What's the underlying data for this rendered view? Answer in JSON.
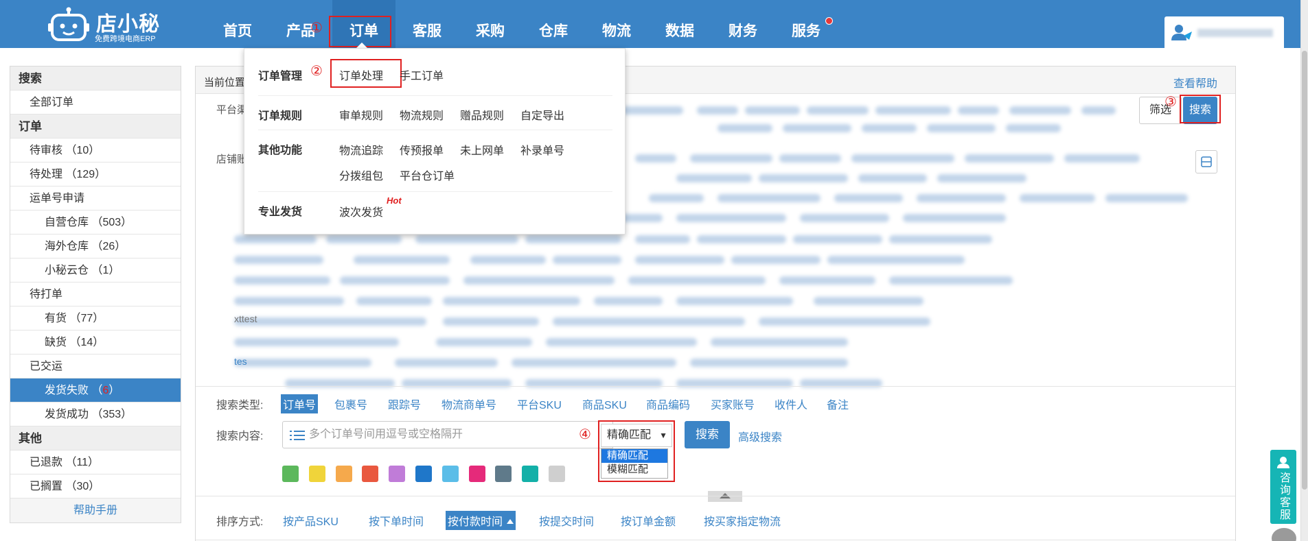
{
  "logo": {
    "name": "店小秘",
    "subtitle": "免费跨境电商ERP"
  },
  "nav": {
    "items": [
      "首页",
      "产品",
      "订单",
      "客服",
      "采购",
      "仓库",
      "物流",
      "数据",
      "财务",
      "服务"
    ],
    "active_index": 2
  },
  "markers": {
    "n1": "①",
    "n2": "②",
    "n3": "③",
    "n4": "④"
  },
  "sidebar": {
    "search_head": "搜索",
    "all_orders": "全部订单",
    "orders_head": "订单",
    "pending_review": "待审核 （10）",
    "pending_process": "待处理 （129）",
    "waybill_apply": "运单号申请",
    "own_warehouse": "自营仓库 （503）",
    "overseas_warehouse": "海外仓库 （26）",
    "xm_cloud": "小秘云仓 （1）",
    "to_print": "待打单",
    "in_stock": "有货 （77）",
    "out_of_stock": "缺货 （14）",
    "shipped": "已交运",
    "ship_failed_label": "发货失败 （",
    "ship_failed_count": "6",
    "ship_failed_close": "）",
    "ship_success": "发货成功 （353）",
    "other_head": "其他",
    "refunded": "已退款 （11）",
    "shelved": "已搁置 （30）",
    "help": "帮助手册"
  },
  "main": {
    "crumb": "当前位置",
    "help_link": "查看帮助",
    "platform_label": "平台渠",
    "shop_label": "店铺账",
    "filter_btn": "筛选",
    "search_btn": "搜索",
    "partial_text_1": "tes",
    "partial_text_2": "xttest",
    "search_type_label": "搜索类型:",
    "search_types": [
      "订单号",
      "包裹号",
      "跟踪号",
      "物流商单号",
      "平台SKU",
      "商品SKU",
      "商品编码",
      "买家账号",
      "收件人",
      "备注"
    ],
    "search_content_label": "搜索内容:",
    "search_placeholder": "多个订单号间用逗号或空格隔开",
    "match_selected": "精确匹配",
    "match_options": [
      "精确匹配",
      "模糊匹配"
    ],
    "main_search_btn": "搜索",
    "advanced_search": "高级搜索",
    "sort_label": "排序方式:",
    "sorts": [
      "按产品SKU",
      "按下单时间",
      "按付款时间",
      "按提交时间",
      "按订单金额",
      "按买家指定物流"
    ],
    "swatch_colors": [
      "#5cb85c",
      "#f0d43a",
      "#f5a94c",
      "#e9583f",
      "#c07cd8",
      "#1f77c9",
      "#5bbde8",
      "#e52a7a",
      "#5f7a8a",
      "#13b0a8",
      "#cfcfcf"
    ]
  },
  "dropdown": {
    "g1": "订单管理",
    "order_process": "订单处理",
    "manual_order": "手工订单",
    "g2": "订单规则",
    "review_rules": "审单规则",
    "logistics_rules": "物流规则",
    "gift_rules": "赠品规则",
    "custom_export": "自定导出",
    "g3": "其他功能",
    "tracking": "物流追踪",
    "pre_report": "传预报单",
    "not_online": "未上网单",
    "add_number": "补录单号",
    "split_pack": "分拨组包",
    "platform_wh_order": "平台仓订单",
    "g4": "专业发货",
    "batch_ship": "波次发货",
    "hot": "Hot"
  },
  "float": {
    "consult": "咨询客服"
  },
  "colors": {
    "primary": "#3b84c6",
    "marker": "#e02020",
    "consult": "#16b5b5"
  }
}
